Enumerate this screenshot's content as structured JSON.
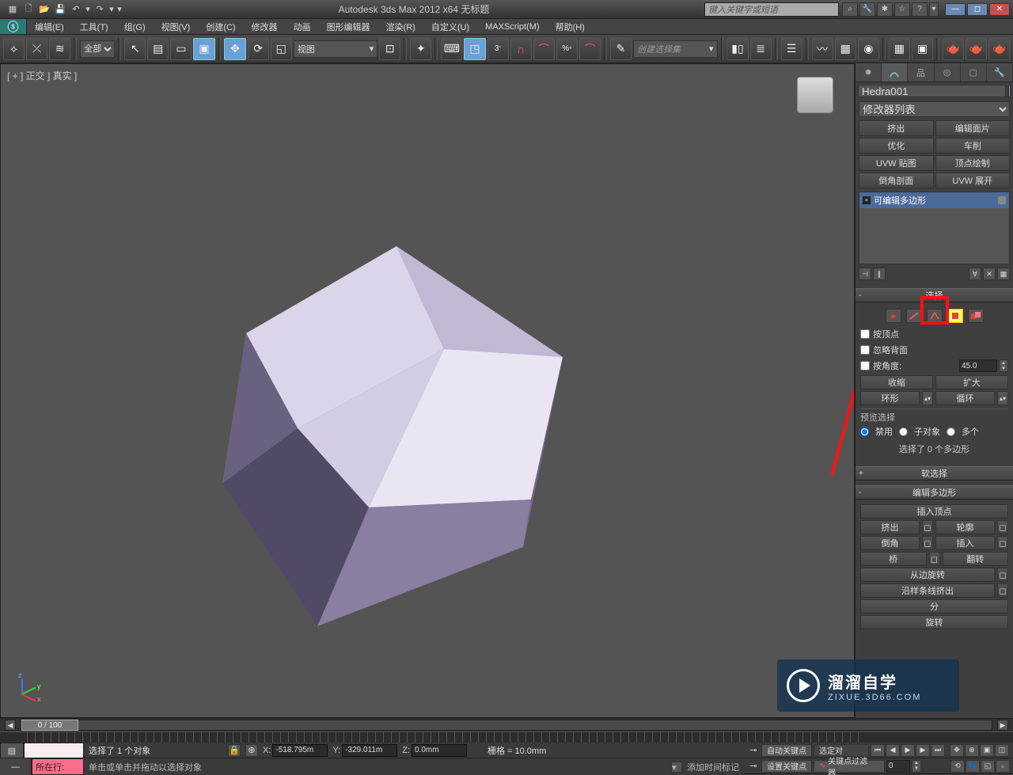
{
  "title": "Autodesk 3ds Max  2012  x64     无标题",
  "search_placeholder": "键入关键字或短语",
  "menus": [
    "编辑(E)",
    "工具(T)",
    "组(G)",
    "视图(V)",
    "创建(C)",
    "修改器",
    "动画",
    "图形编辑器",
    "渲染(R)",
    "自定义(U)",
    "MAXScript(M)",
    "帮助(H)"
  ],
  "toolbar": {
    "filter_all": "全部",
    "view_combo": "视图",
    "selection_set": "创建选择集"
  },
  "viewport": {
    "label": "[ + ] 正交 ] 真实  ]"
  },
  "cmdpanel": {
    "object_name": "Hedra001",
    "modifier_list": "修改器列表",
    "mod_buttons": [
      "挤出",
      "编辑面片",
      "优化",
      "车削",
      "UVW 贴图",
      "顶点绘制",
      "倒角剖面",
      "UVW 展开"
    ],
    "stack_item": "可编辑多边形",
    "rollouts": {
      "selection": {
        "title": "选择",
        "by_vertex": "按顶点",
        "ignore_backfacing": "忽略背面",
        "by_angle": "按角度:",
        "angle_val": "45.0",
        "shrink": "收缩",
        "grow": "扩大",
        "ring": "环形",
        "loop": "循环",
        "preview_label": "预览选择",
        "preview_off": "禁用",
        "preview_subobj": "子对象",
        "preview_multi": "多个",
        "selected_text": "选择了 0 个多边形"
      },
      "soft_sel": "软选择",
      "edit_poly": {
        "title": "编辑多边形",
        "insert_vertex": "插入顶点",
        "extrude": "挤出",
        "outline": "轮廓",
        "bevel": "倒角",
        "inset": "插入",
        "bridge": "桥",
        "flip": "翻转",
        "hinge": "从边旋转",
        "extrude_spline": "沿样条线挤出",
        "split": "分",
        "rotate": "旋转"
      }
    }
  },
  "timeline": {
    "frame_label": "0 / 100"
  },
  "status": {
    "cmdline_label": "所在行:",
    "sel_text": "选择了 1 个对象",
    "prompt": "单击或单击并拖动以选择对象",
    "x": "-518.795m",
    "y": "-329.011m",
    "z": "0.0mm",
    "grid": "栅格 = 10.0mm",
    "add_time_tag": "添加时间标记",
    "auto_key": "自动关键点",
    "set_key": "设置关键点",
    "sel_combo": "选定对",
    "key_filter": "关键点过滤器..."
  },
  "watermark": {
    "big": "溜溜自学",
    "small": "ZIXUE.3D66.COM"
  }
}
